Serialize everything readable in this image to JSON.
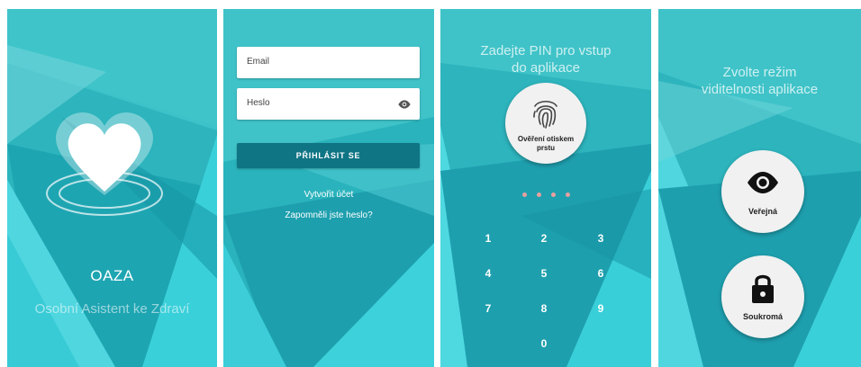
{
  "screen_splash": {
    "app_name": "OAZA",
    "subtitle": "Osobní Asistent ke Zdraví",
    "logo_icon": "heart-logo-icon"
  },
  "screen_login": {
    "email_placeholder": "Email",
    "password_placeholder": "Heslo",
    "password_toggle_icon": "eye-icon",
    "login_button": "PŘIHLÁSIT SE",
    "create_account_link": "Vytvořit účet",
    "forgot_password_link": "Zapomněli jste heslo?"
  },
  "screen_pin": {
    "title_line1": "Zadejte PIN pro vstup",
    "title_line2": "do aplikace",
    "fingerprint_label_line1": "Ověření otiskem",
    "fingerprint_label_line2": "prstu",
    "fingerprint_icon": "fingerprint-icon",
    "pin_length": 4,
    "keys": [
      "1",
      "2",
      "3",
      "4",
      "5",
      "6",
      "7",
      "8",
      "9",
      "0"
    ],
    "dot_color": "#e8a0a0"
  },
  "screen_visibility": {
    "title_line1": "Zvolte režim",
    "title_line2": "viditelnosti aplikace",
    "public_label": "Veřejná",
    "public_icon": "eye-icon",
    "private_label": "Soukromá",
    "private_icon": "lock-icon"
  },
  "colors": {
    "background": "#3cc2c8",
    "button_primary": "#0f7484",
    "text_light": "#ffffff"
  }
}
